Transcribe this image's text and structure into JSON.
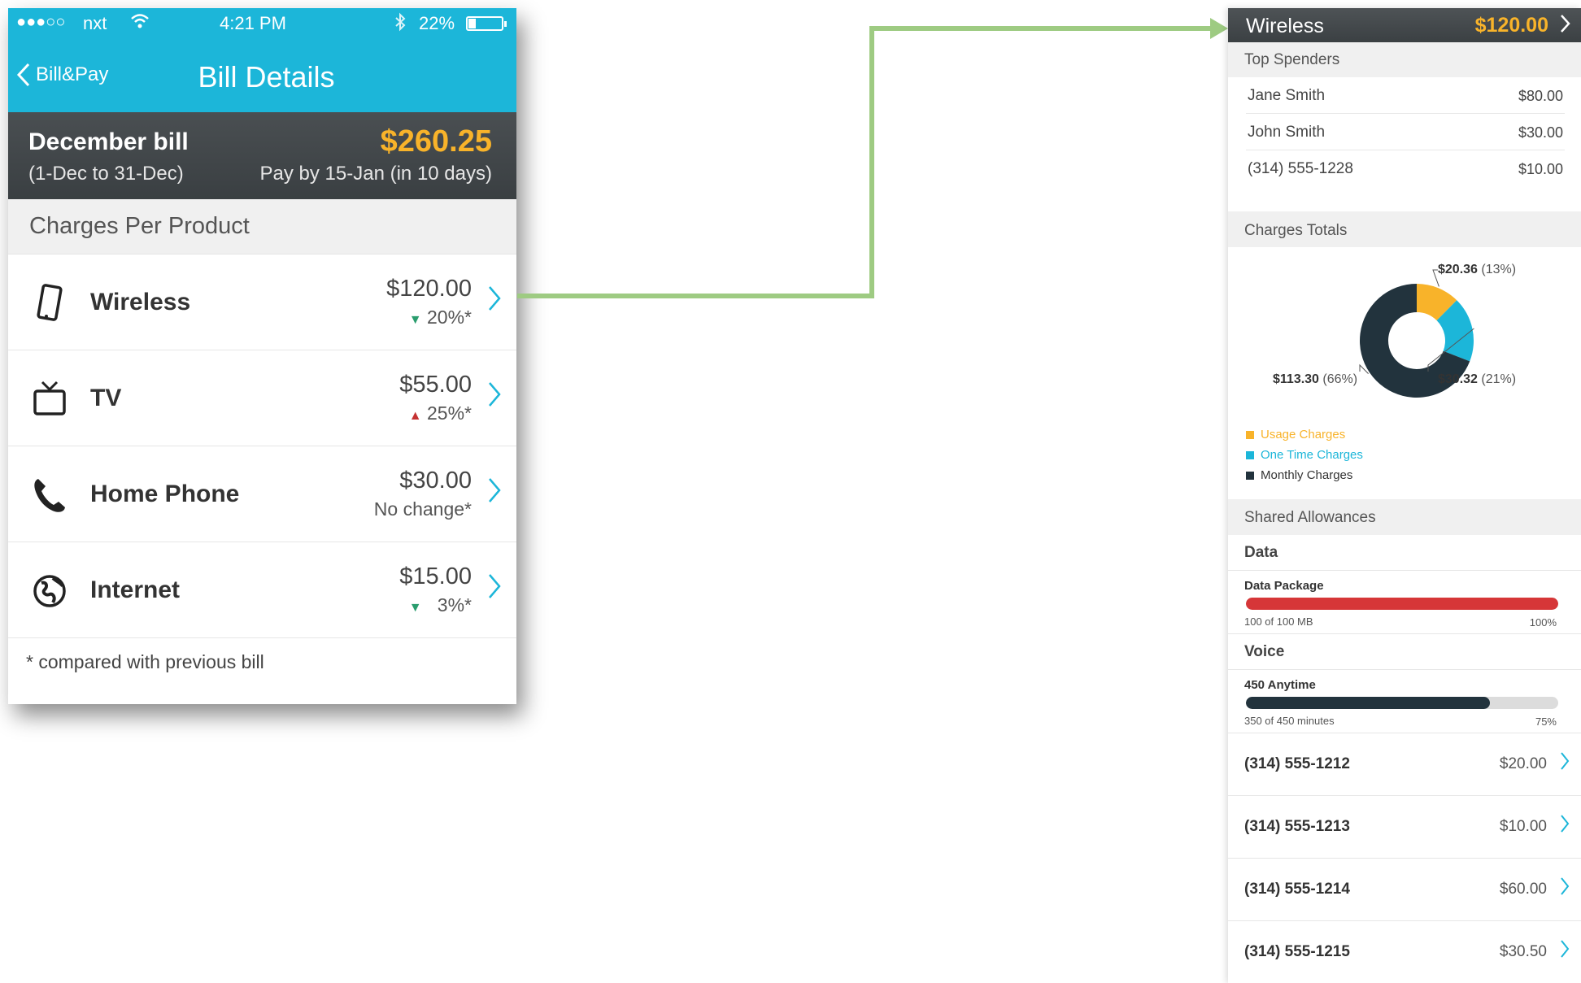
{
  "phone": {
    "status_bar": {
      "signal": "●●●○○",
      "carrier": "nxt",
      "time": "4:21 PM",
      "battery": "22%"
    },
    "nav": {
      "back_label": "Bill&Pay",
      "title": "Bill Details"
    },
    "bill": {
      "name": "December bill",
      "range": "(1-Dec to 31-Dec)",
      "amount": "$260.25",
      "due": "Pay by 15-Jan (in 10 days)"
    },
    "section_title": "Charges Per Product",
    "products": [
      {
        "icon": "mobile-phone-icon",
        "name": "Wireless",
        "amount": "$120.00",
        "trend": "down",
        "change": "20%"
      },
      {
        "icon": "tv-icon",
        "name": "TV",
        "amount": "$55.00",
        "trend": "up",
        "change": "25%"
      },
      {
        "icon": "phone-handset-icon",
        "name": "Home Phone",
        "amount": "$30.00",
        "trend": "none",
        "change": "No change"
      },
      {
        "icon": "globe-icon",
        "name": "Internet",
        "amount": "$15.00",
        "trend": "down",
        "change": "3%"
      }
    ],
    "footnote": "compared with previous bill"
  },
  "panel": {
    "header": {
      "title": "Wireless",
      "amount": "$120.00"
    },
    "top_spenders_title": "Top Spenders",
    "spenders": [
      {
        "name": "Jane Smith",
        "amount": "$80.00"
      },
      {
        "name": "John Smith",
        "amount": "$30.00"
      },
      {
        "name": "(314) 555-1228",
        "amount": "$10.00"
      }
    ],
    "charges_totals_title": "Charges Totals",
    "shared_allowances_title": "Shared Allowances",
    "data": {
      "title": "Data",
      "package": "Data Package",
      "usage": "100 of 100 MB",
      "percent_label": "100%",
      "fraction": 1.0,
      "color": "#d63638"
    },
    "voice": {
      "title": "Voice",
      "package": "450 Anytime",
      "usage": "350 of 450 minutes",
      "percent_label": "75%",
      "fraction": 0.78,
      "color": "#22333d"
    },
    "lines": [
      {
        "number": "(314) 555-1212",
        "amount": "$20.00"
      },
      {
        "number": "(314) 555-1213",
        "amount": "$10.00"
      },
      {
        "number": "(314) 555-1214",
        "amount": "$60.00"
      },
      {
        "number": "(314) 555-1215",
        "amount": "$30.50"
      }
    ]
  },
  "chart_data": {
    "type": "pie",
    "variant": "donut",
    "title": "",
    "slices": [
      {
        "label": "Usage Charges",
        "value": 20.36,
        "value_label": "$20.36",
        "percent_label": "(13%)",
        "color": "#f8b32a"
      },
      {
        "label": "One Time Charges",
        "value": 30.32,
        "value_label": "$30.32",
        "percent_label": "(21%)",
        "color": "#1cb6d9"
      },
      {
        "label": "Monthly Charges",
        "value": 113.3,
        "value_label": "$113.30",
        "percent_label": "(66%)",
        "color": "#22333d"
      }
    ],
    "legend_position": "bottom-left"
  },
  "colors": {
    "accent": "#1cb6d9",
    "amount_highlight": "#f8b32a",
    "arrow": "#9ecb82",
    "trend_down": "#2a9d6e",
    "trend_up": "#c53333"
  }
}
